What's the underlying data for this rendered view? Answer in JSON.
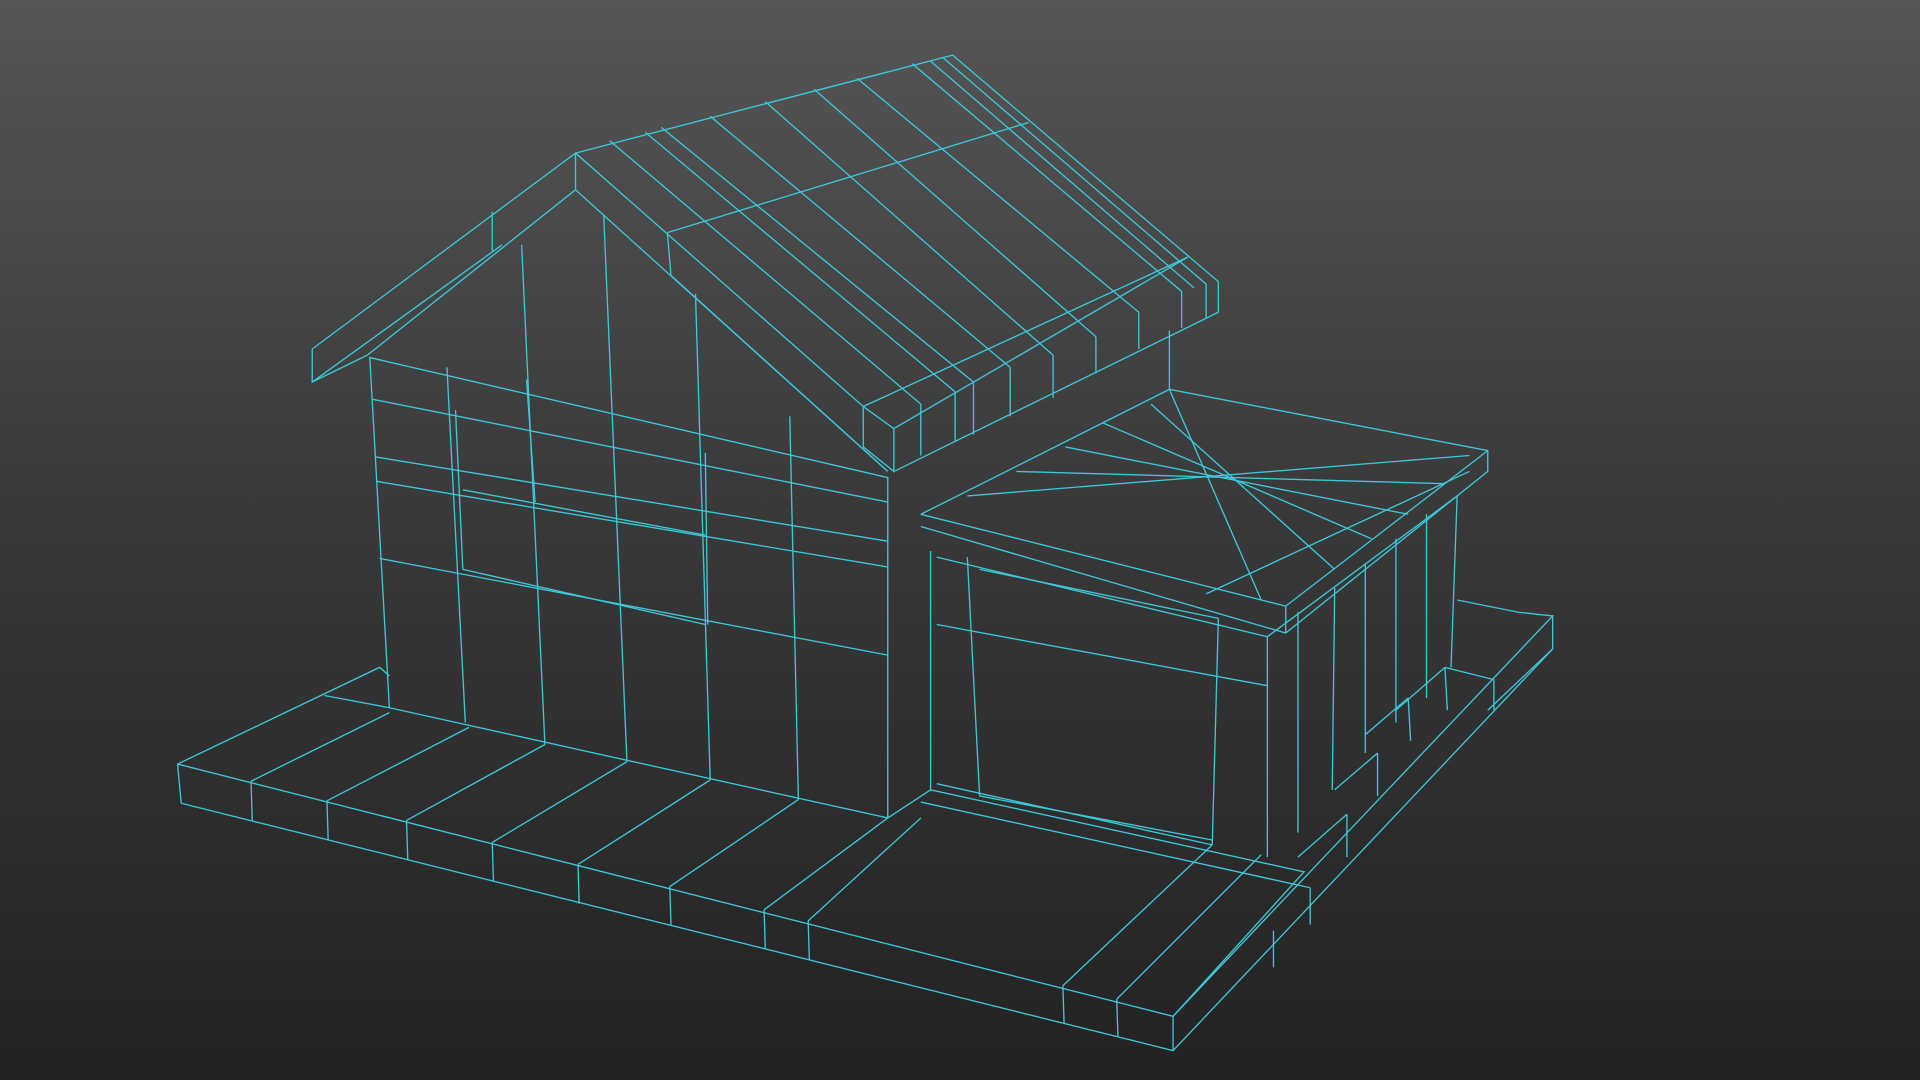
{
  "viewport": {
    "background_top": "#565656",
    "background_bottom": "#222222",
    "wireframe_color": "#3cc8d8",
    "model": "house-wireframe"
  }
}
